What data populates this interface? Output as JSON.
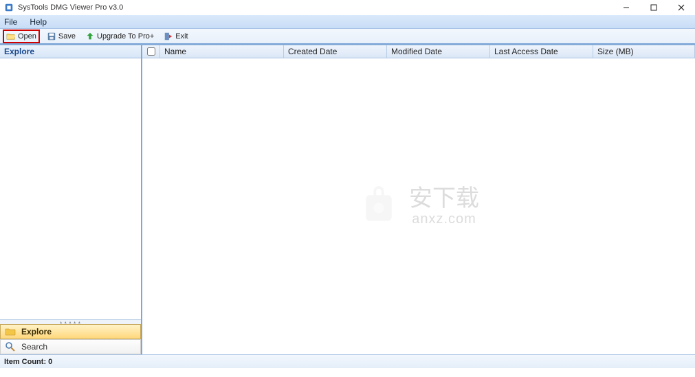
{
  "window": {
    "title": "SysTools DMG Viewer Pro v3.0"
  },
  "menubar": {
    "file": "File",
    "help": "Help"
  },
  "toolbar": {
    "open": "Open",
    "save": "Save",
    "upgrade": "Upgrade To Pro+",
    "exit": "Exit"
  },
  "left": {
    "header": "Explore",
    "nav_explore": "Explore",
    "nav_search": "Search"
  },
  "grid": {
    "columns": {
      "name": "Name",
      "created": "Created Date",
      "modified": "Modified Date",
      "access": "Last Access Date",
      "size": "Size (MB)"
    }
  },
  "watermark": {
    "line1": "安下载",
    "line2": "anxz.com"
  },
  "status": {
    "item_count_label": "Item Count: 0"
  }
}
